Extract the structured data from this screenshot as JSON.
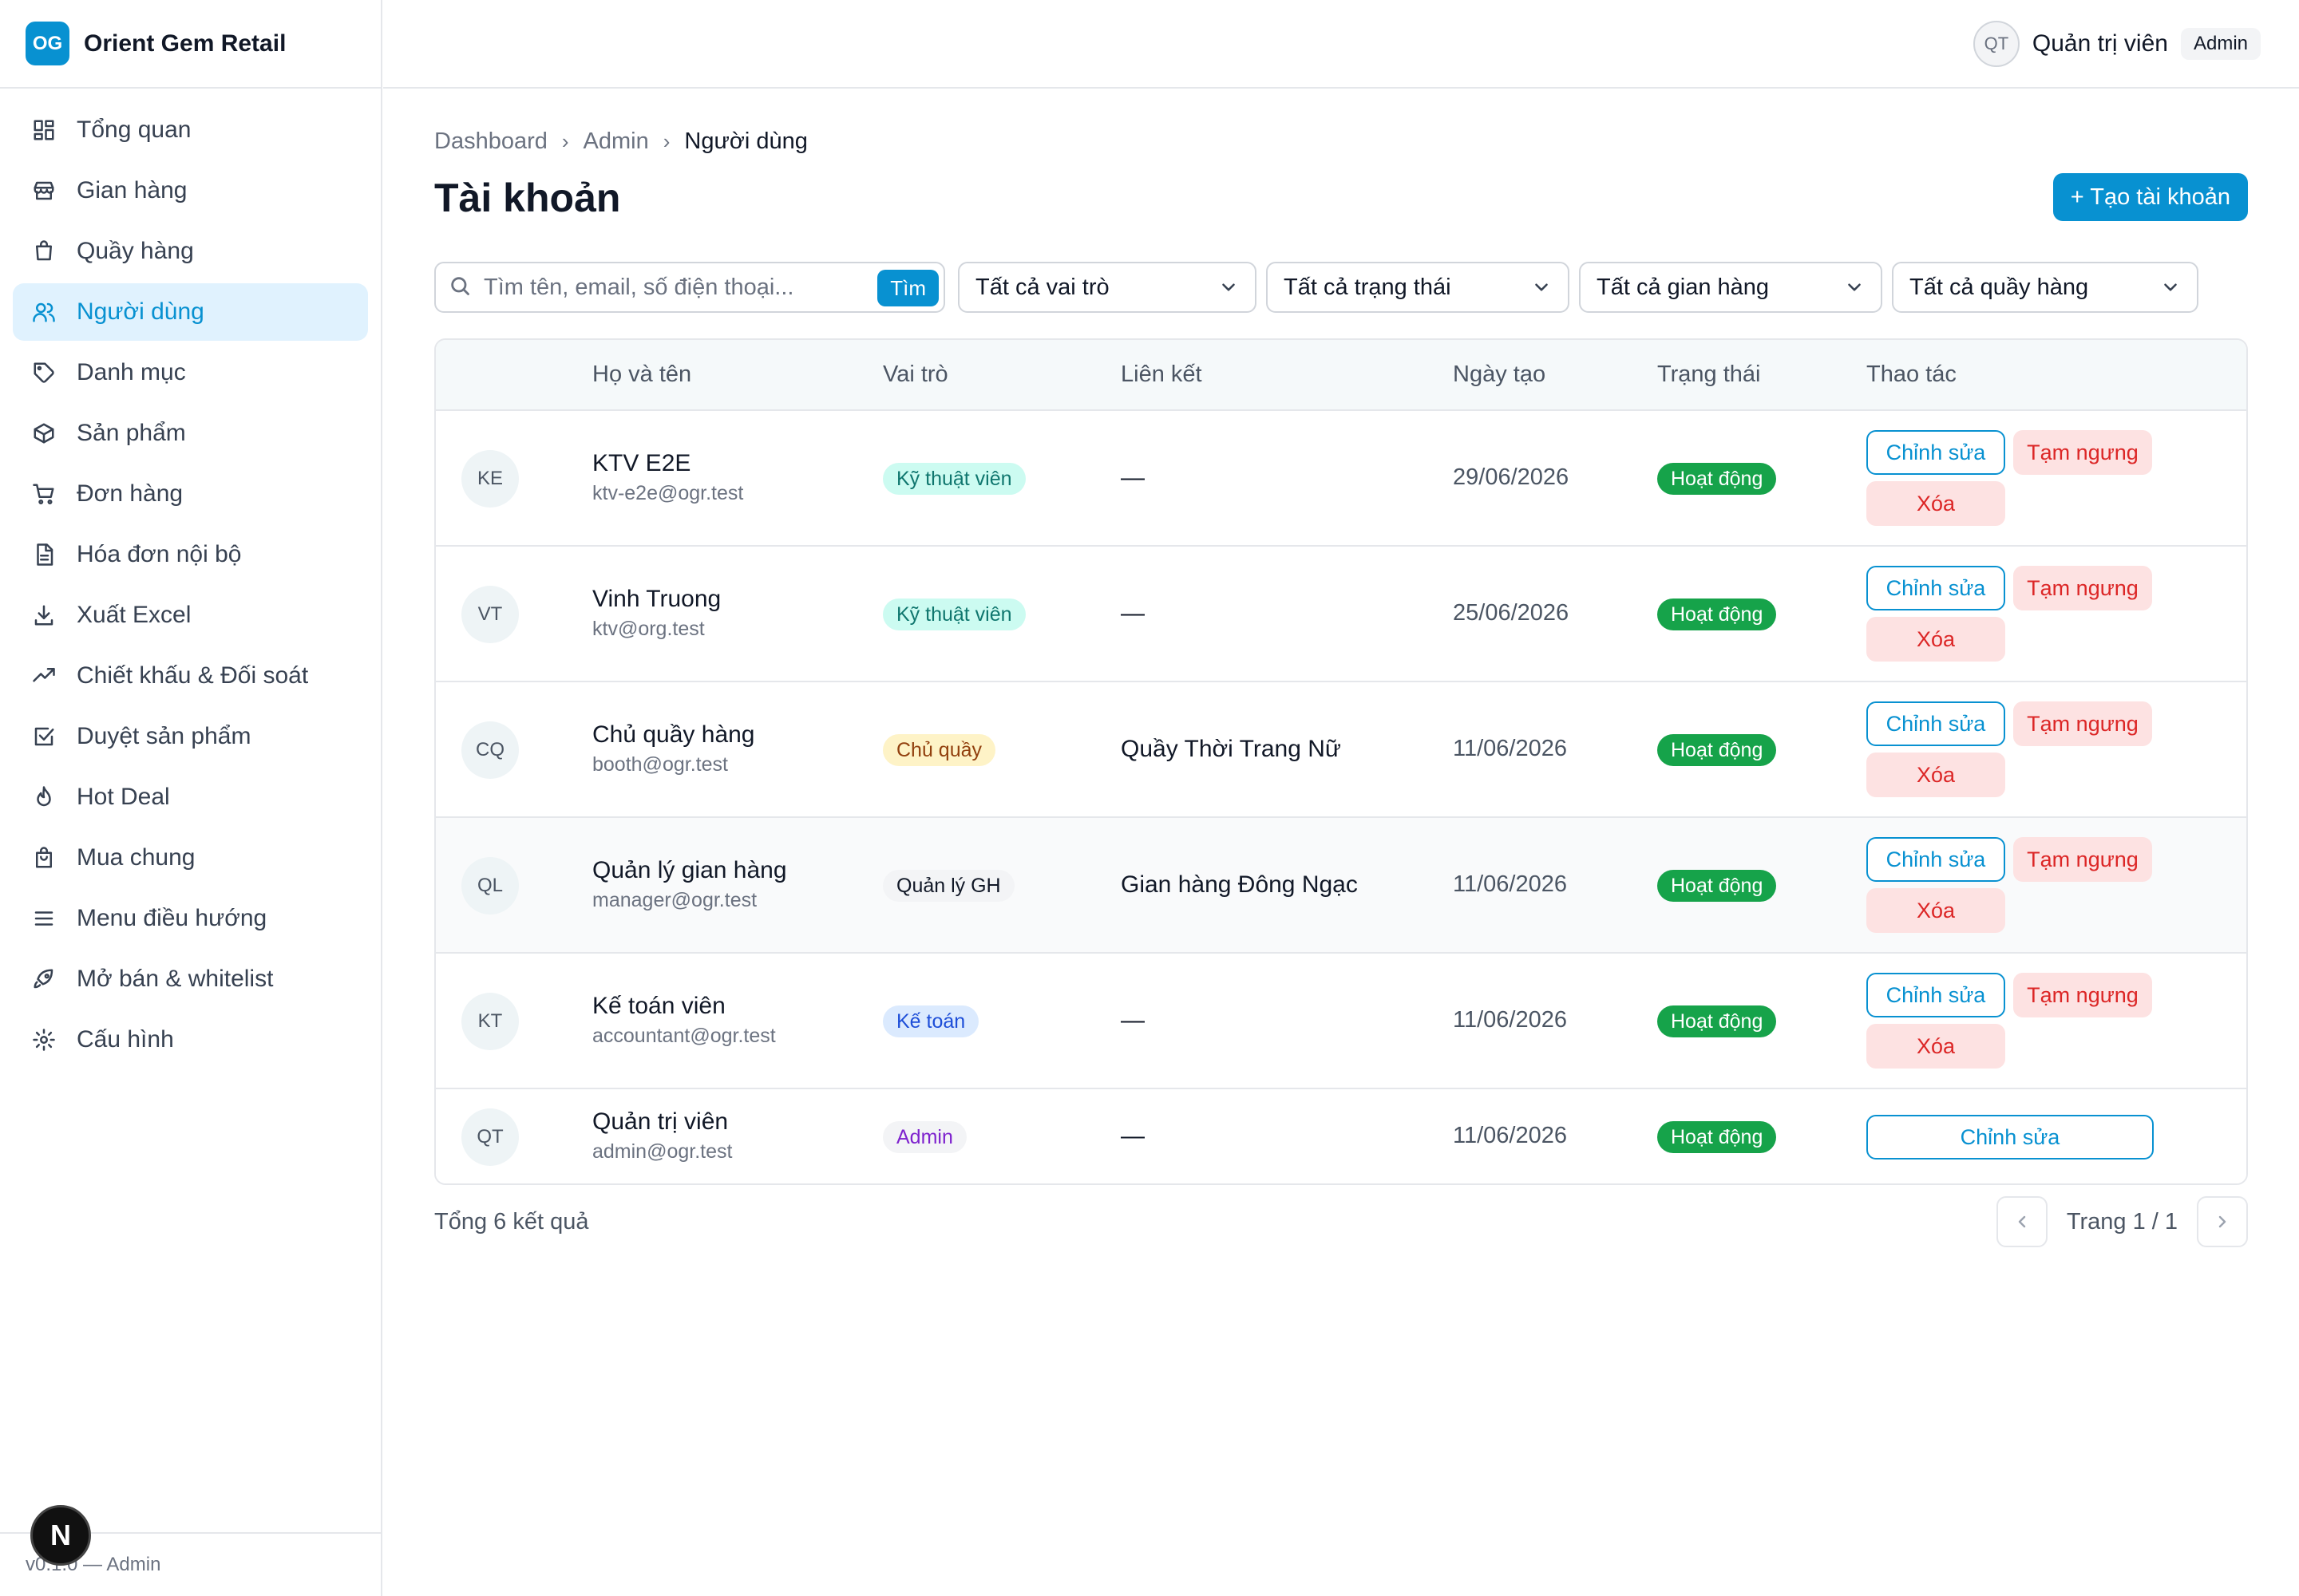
{
  "brand": {
    "logo": "OG",
    "name": "Orient Gem Retail"
  },
  "header": {
    "avatar_initials": "QT",
    "user_name": "Quản trị viên",
    "user_role": "Admin"
  },
  "sidebar": {
    "items": [
      {
        "label": "Tổng quan",
        "icon": "dashboard-icon"
      },
      {
        "label": "Gian hàng",
        "icon": "store-icon"
      },
      {
        "label": "Quầy hàng",
        "icon": "booth-icon"
      },
      {
        "label": "Người dùng",
        "icon": "users-icon",
        "active": true
      },
      {
        "label": "Danh mục",
        "icon": "tag-icon"
      },
      {
        "label": "Sản phẩm",
        "icon": "box-icon"
      },
      {
        "label": "Đơn hàng",
        "icon": "cart-icon"
      },
      {
        "label": "Hóa đơn nội bộ",
        "icon": "invoice-icon"
      },
      {
        "label": "Xuất Excel",
        "icon": "download-icon"
      },
      {
        "label": "Chiết khấu & Đối soát",
        "icon": "trend-icon"
      },
      {
        "label": "Duyệt sản phẩm",
        "icon": "check-square-icon"
      },
      {
        "label": "Hot Deal",
        "icon": "flame-icon"
      },
      {
        "label": "Mua chung",
        "icon": "bag-icon"
      },
      {
        "label": "Menu điều hướng",
        "icon": "menu-icon"
      },
      {
        "label": "Mở bán & whitelist",
        "icon": "rocket-icon"
      },
      {
        "label": "Cấu hình",
        "icon": "gear-icon"
      }
    ],
    "footer": "v0.1.0 — Admin",
    "next_badge": "N"
  },
  "breadcrumb": [
    "Dashboard",
    "Admin",
    "Người dùng"
  ],
  "page": {
    "title": "Tài khoản",
    "create_button": "+ Tạo tài khoản"
  },
  "filters": {
    "search_placeholder": "Tìm tên, email, số điện thoại...",
    "search_button": "Tìm",
    "role": "Tất cả vai trò",
    "status": "Tất cả trạng thái",
    "store": "Tất cả gian hàng",
    "booth": "Tất cả quầy hàng"
  },
  "table": {
    "columns": [
      "Họ và tên",
      "Vai trò",
      "Liên kết",
      "Ngày tạo",
      "Trạng thái",
      "Thao tác"
    ],
    "rows": [
      {
        "initials": "KE",
        "name": "KTV E2E",
        "email": "ktv-e2e@ogr.test",
        "role": "Kỹ thuật viên",
        "link": "—",
        "created": "29/06/2026",
        "status": "Hoạt động"
      },
      {
        "initials": "VT",
        "name": "Vinh Truong",
        "email": "ktv@org.test",
        "role": "Kỹ thuật viên",
        "link": "—",
        "created": "25/06/2026",
        "status": "Hoạt động"
      },
      {
        "initials": "CQ",
        "name": "Chủ quầy hàng",
        "email": "booth@ogr.test",
        "role": "Chủ quầy",
        "link": "Quầy Thời Trang Nữ",
        "created": "11/06/2026",
        "status": "Hoạt động"
      },
      {
        "initials": "QL",
        "name": "Quản lý gian hàng",
        "email": "manager@ogr.test",
        "role": "Quản lý GH",
        "link": "Gian hàng Đông Ngạc",
        "created": "11/06/2026",
        "status": "Hoạt động"
      },
      {
        "initials": "KT",
        "name": "Kế toán viên",
        "email": "accountant@ogr.test",
        "role": "Kế toán",
        "link": "—",
        "created": "11/06/2026",
        "status": "Hoạt động"
      },
      {
        "initials": "QT",
        "name": "Quản trị viên",
        "email": "admin@ogr.test",
        "role": "Admin",
        "link": "—",
        "created": "11/06/2026",
        "status": "Hoạt động"
      }
    ],
    "actions": {
      "edit": "Chỉnh sửa",
      "suspend": "Tạm ngưng",
      "delete": "Xóa"
    }
  },
  "footer": {
    "total": "Tổng 6 kết quả",
    "page_label": "Trang 1 / 1"
  },
  "colors": {
    "accent": "#0891d1",
    "success": "#16a34a",
    "danger": "#dc2626",
    "danger_bg": "#fde2e2"
  },
  "role_colors": {
    "Kỹ thuật viên": {
      "bg": "#ccfbf1",
      "fg": "#0f766e"
    },
    "Chủ quầy": {
      "bg": "#fef3c7",
      "fg": "#92400e"
    },
    "Quản lý GH": {
      "bg": "#f3f4f6",
      "fg": "#111827"
    },
    "Kế toán": {
      "bg": "#dbeafe",
      "fg": "#1d4ed8"
    },
    "Admin": {
      "bg": "#f3f4f6",
      "fg": "#7e22ce"
    }
  }
}
